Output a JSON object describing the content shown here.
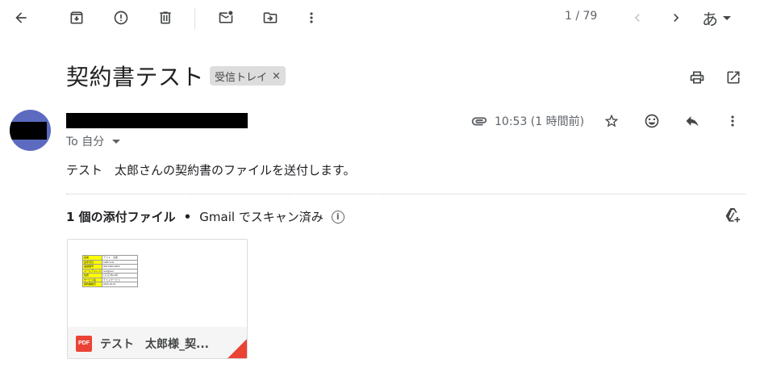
{
  "toolbar": {
    "back_icon": "arrow-back-icon",
    "archive_icon": "archive-icon",
    "spam_icon": "report-spam-icon",
    "delete_icon": "trash-icon",
    "unread_icon": "mark-unread-icon",
    "move_icon": "move-to-folder-icon",
    "more_icon": "more-vert-icon",
    "pager_text": "1 / 79",
    "ime_label": "あ"
  },
  "subject": "契約書テスト",
  "label_chip": {
    "text": "受信トレイ",
    "close": "×"
  },
  "header_actions": {
    "print_icon": "print-icon",
    "open_new_window_icon": "open-in-new-icon"
  },
  "message": {
    "to_text": "To 自分",
    "time": "10:53 (1 時間前)",
    "body": "テスト　太郎さんの契約書のファイルを送付します。"
  },
  "attachments": {
    "count_text": "1 個の添付ファイル",
    "separator": "•",
    "scan_text": "Gmail でスキャン済み",
    "info": "i",
    "file": {
      "type_badge": "PDF",
      "name": "テスト　太郎様_契...",
      "preview_rows": [
        [
          "名前",
          "テスト　太郎"
        ],
        [
          "生年月日",
          "1985-4-01"
        ],
        [
          "電話番号",
          "000-0000-0000"
        ],
        [
          "メールアドレス",
          "test@test"
        ],
        [
          "住所",
          "〇〇〇市xx町"
        ],
        [
          "サービス名",
          "テストサービス"
        ],
        [
          "契約開始日",
          "2025-04-01"
        ]
      ]
    }
  },
  "colors": {
    "avatar": "#5c6bc0",
    "pdf_red": "#ea4335",
    "preview_key": "#ffff00"
  }
}
